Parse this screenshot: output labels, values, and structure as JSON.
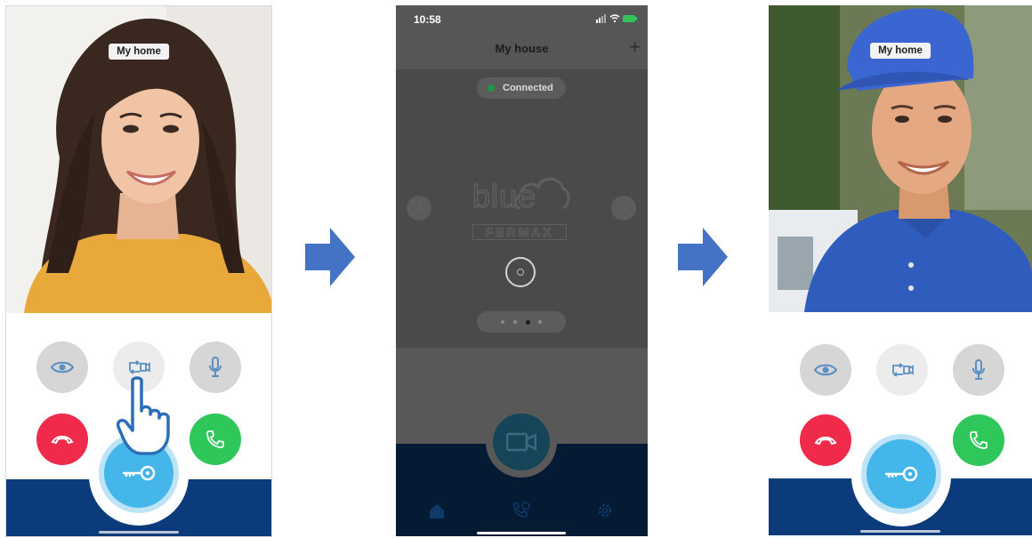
{
  "steps": {
    "left_phone": {
      "location_label": "My home",
      "buttons": [
        "eye-icon",
        "switch-camera-icon",
        "microphone-icon",
        "hang-up-icon",
        "answer-icon",
        "key-icon"
      ],
      "touch_indicator": "pointing-hand-icon"
    },
    "middle_phone": {
      "status_bar_time": "10:58",
      "header_title": "My house",
      "add_button": "+",
      "connection_status": "Connected",
      "logo_text": "blue",
      "logo_subtext": "FERMAX",
      "carousel_pages": 4,
      "carousel_active_page": 3,
      "tab_icons": [
        "home-icon",
        "call-history-icon",
        "settings-icon"
      ]
    },
    "right_phone": {
      "location_label": "My home",
      "buttons": [
        "eye-icon",
        "switch-camera-icon",
        "microphone-icon",
        "hang-up-icon",
        "answer-icon",
        "key-icon"
      ]
    }
  },
  "colors": {
    "arrow": "#4472c4",
    "hang_up": "#ef2a4b",
    "answer": "#2fc75a",
    "open_door": "#44b6ea",
    "bottom_bar": "#0c3b7c"
  }
}
